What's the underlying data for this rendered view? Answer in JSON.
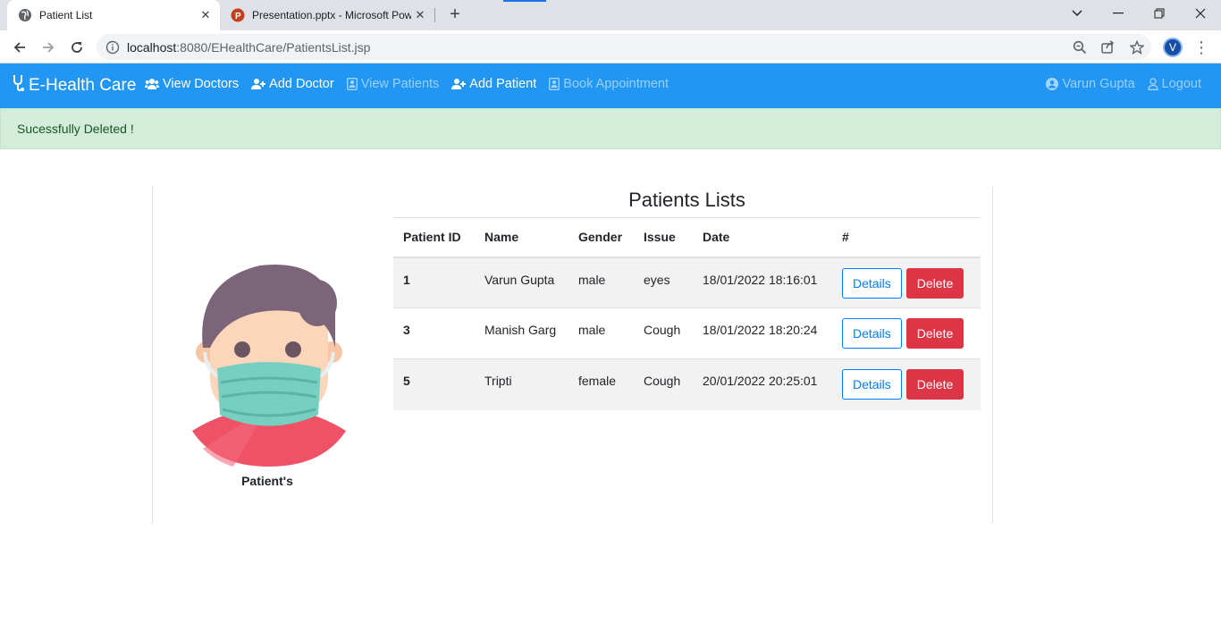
{
  "browser": {
    "tabs": [
      {
        "title": "Patient List",
        "active": true
      },
      {
        "title": "Presentation.pptx - Microsoft Pow",
        "active": false
      }
    ],
    "url_host": "localhost",
    "url_rest": ":8080/EHealthCare/PatientsList.jsp",
    "profile_initial": "V"
  },
  "navbar": {
    "brand": "E-Health Care",
    "links": [
      {
        "label": "View Doctors"
      },
      {
        "label": "Add Doctor"
      },
      {
        "label": "View Patients"
      },
      {
        "label": "Add Patient"
      },
      {
        "label": "Book Appointment"
      }
    ],
    "user": "Varun Gupta",
    "logout": "Logout"
  },
  "alert": {
    "message": "Sucessfully Deleted !"
  },
  "sidebar": {
    "caption": "Patient's"
  },
  "table": {
    "title": "Patients Lists",
    "headers": [
      "Patient ID",
      "Name",
      "Gender",
      "Issue",
      "Date",
      "#"
    ],
    "rows": [
      {
        "id": "1",
        "name": "Varun Gupta",
        "gender": "male",
        "issue": "eyes",
        "date": "18/01/2022 18:16:01"
      },
      {
        "id": "3",
        "name": "Manish Garg",
        "gender": "male",
        "issue": "Cough",
        "date": "18/01/2022 18:20:24"
      },
      {
        "id": "5",
        "name": "Tripti",
        "gender": "female",
        "issue": "Cough",
        "date": "20/01/2022 20:25:01"
      }
    ],
    "details_label": "Details",
    "delete_label": "Delete"
  },
  "colors": {
    "navbar": "#2196f3",
    "alert_bg": "#d4edda",
    "alert_text": "#155724",
    "details": "#007bff",
    "delete": "#dc3545"
  },
  "icons": {
    "brand": "stethoscope-icon",
    "view_doctors": "users-icon",
    "add_doctor": "user-plus-icon",
    "view_patients": "id-card-icon",
    "add_patient": "user-plus-icon",
    "book_appointment": "id-card-icon",
    "user": "user-circle-icon",
    "logout": "user-outline-icon"
  }
}
